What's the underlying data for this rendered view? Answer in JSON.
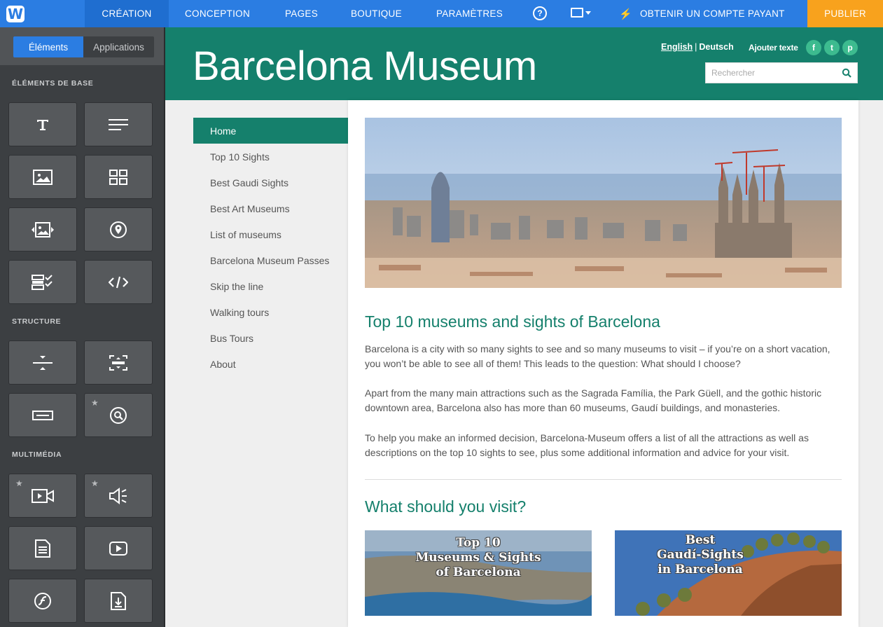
{
  "topbar": {
    "logo": "W",
    "tabs": {
      "creation": "CRÉATION",
      "conception": "CONCEPTION",
      "pages": "PAGES",
      "boutique": "BOUTIQUE",
      "parametres": "PARAMÈTRES"
    },
    "help_icon": "?",
    "upgrade_label": "OBTENIR UN COMPTE PAYANT",
    "publish_label": "PUBLIER",
    "colors": {
      "bar": "#2b7de2",
      "active_tab": "#1f6ed0",
      "publish": "#f8a21d"
    }
  },
  "sidebar": {
    "tabs": {
      "elements": "Éléments",
      "apps": "Applications"
    },
    "sections": {
      "base": "ÉLÉMENTS DE BASE",
      "structure": "STRUCTURE",
      "multimedia": "MULTIMÉDIA"
    },
    "tiles": [
      {
        "icon": "title-icon"
      },
      {
        "icon": "text-icon"
      },
      {
        "icon": "image-icon"
      },
      {
        "icon": "gallery-icon"
      },
      {
        "icon": "slideshow-icon"
      },
      {
        "icon": "map-icon"
      },
      {
        "icon": "form-icon"
      },
      {
        "icon": "embed-code-icon"
      },
      {
        "icon": "spacer-icon"
      },
      {
        "icon": "divider-icon"
      },
      {
        "icon": "button-icon"
      },
      {
        "icon": "search-box-icon",
        "premium": true
      },
      {
        "icon": "video-icon",
        "premium": true
      },
      {
        "icon": "audio-icon",
        "premium": true
      },
      {
        "icon": "document-icon"
      },
      {
        "icon": "youtube-icon"
      },
      {
        "icon": "flash-icon"
      },
      {
        "icon": "file-download-icon"
      }
    ],
    "premium_star": "★"
  },
  "site": {
    "title": "Barcelona Museum",
    "lang": {
      "english": "English",
      "sep": "|",
      "deutsch": "Deutsch"
    },
    "add_text": "Ajouter texte",
    "social": {
      "facebook": "f",
      "twitter": "t",
      "pinterest": "p"
    },
    "search": {
      "placeholder": "Rechercher"
    },
    "nav": [
      "Home",
      "Top 10 Sights",
      "Best Gaudi Sights",
      "Best Art Museums",
      "List of museums",
      "Barcelona Museum Passes",
      "Skip the line",
      "Walking tours",
      "Bus Tours",
      "About"
    ],
    "heading_top": "Top 10 museums and sights of Barcelona",
    "paragraphs": [
      "Barcelona is a city with so many sights to see and so many museums to visit – if you’re on a short vacation, you won’t be able to see all of them! This leads to the question: What should I choose?",
      "Apart from the many main attractions such as the Sagrada Família, the Park Güell, and the gothic historic downtown area, Barcelona also has more than 60 museums, Gaudí buildings, and monasteries.",
      "To help you make an informed decision, Barcelona-Museum offers a list of all the attractions as well as descriptions on the top 10 sights to see, plus some additional information and advice for your visit."
    ],
    "heading_visit": "What should you visit?",
    "thumbs": [
      "Top 10\nMuseums & Sights\nof Barcelona",
      "Best\nGaudí-Sights\nin Barcelona"
    ],
    "colors": {
      "header": "#15806c",
      "social": "#3dbb8f"
    }
  }
}
